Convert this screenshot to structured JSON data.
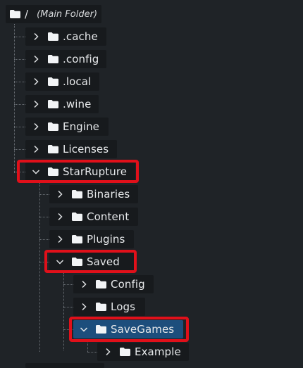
{
  "tree": {
    "root": {
      "label": "/",
      "sublabel": "(Main Folder)"
    },
    "items": [
      {
        "label": ".cache",
        "state": "collapsed"
      },
      {
        "label": ".config",
        "state": "collapsed"
      },
      {
        "label": ".local",
        "state": "collapsed"
      },
      {
        "label": ".wine",
        "state": "collapsed"
      },
      {
        "label": "Engine",
        "state": "collapsed"
      },
      {
        "label": "Licenses",
        "state": "collapsed"
      },
      {
        "label": "StarRupture",
        "state": "expanded",
        "highlighted": true
      },
      {
        "label": "Binaries",
        "state": "collapsed"
      },
      {
        "label": "Content",
        "state": "collapsed"
      },
      {
        "label": "Plugins",
        "state": "collapsed"
      },
      {
        "label": "Saved",
        "state": "expanded",
        "highlighted": true
      },
      {
        "label": "Config",
        "state": "collapsed"
      },
      {
        "label": "Logs",
        "state": "collapsed"
      },
      {
        "label": "SaveGames",
        "state": "expanded",
        "highlighted": true,
        "selected": true
      },
      {
        "label": "Example",
        "state": "collapsed"
      }
    ]
  },
  "colors": {
    "background": "#1f2327",
    "node_background": "#171a1d",
    "selected_background": "#1d4e7c",
    "highlight_border": "#e0101a",
    "text": "#e6e8ea",
    "folder_icon": "#f2f4f6"
  }
}
